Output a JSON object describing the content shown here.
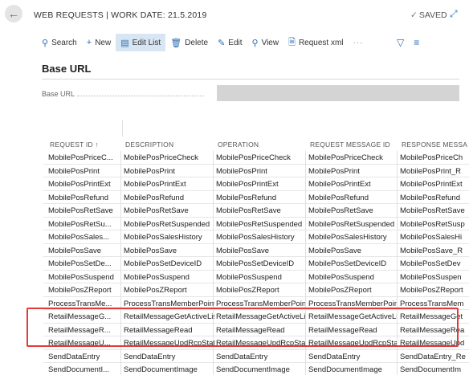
{
  "header": {
    "back_icon": "arrow-left-icon",
    "title": "WEB REQUESTS | WORK DATE: 21.5.2019",
    "saved_label": "SAVED",
    "expand_icon": "expand-icon"
  },
  "toolbar": {
    "search": "Search",
    "new": "New",
    "edit_list": "Edit List",
    "delete": "Delete",
    "edit": "Edit",
    "view": "View",
    "request_xml": "Request xml",
    "more": "···"
  },
  "section": {
    "title": "Base URL",
    "field_label": "Base URL",
    "field_value": ""
  },
  "table": {
    "columns": [
      "REQUEST ID ↑",
      "DESCRIPTION",
      "OPERATION",
      "REQUEST MESSAGE ID",
      "RESPONSE MESSA"
    ],
    "rows": [
      [
        "MobilePosPriceC...",
        "MobilePosPriceCheck",
        "MobilePosPriceCheck",
        "MobilePosPriceCheck",
        "MobilePosPriceCh"
      ],
      [
        "MobilePosPrint",
        "MobilePosPrint",
        "MobilePosPrint",
        "MobilePosPrint",
        "MobilePosPrint_R"
      ],
      [
        "MobilePosPrintExt",
        "MobilePosPrintExt",
        "MobilePosPrintExt",
        "MobilePosPrintExt",
        "MobilePosPrintExt"
      ],
      [
        "MobilePosRefund",
        "MobilePosRefund",
        "MobilePosRefund",
        "MobilePosRefund",
        "MobilePosRefund"
      ],
      [
        "MobilePosRetSave",
        "MobilePosRetSave",
        "MobilePosRetSave",
        "MobilePosRetSave",
        "MobilePosRetSave"
      ],
      [
        "MobilePosRetSu...",
        "MobilePosRetSuspended",
        "MobilePosRetSuspended",
        "MobilePosRetSuspended",
        "MobilePosRetSusp"
      ],
      [
        "MobilePosSales...",
        "MobilePosSalesHistory",
        "MobilePosSalesHistory",
        "MobilePosSalesHistory",
        "MobilePosSalesHi"
      ],
      [
        "MobilePosSave",
        "MobilePosSave",
        "MobilePosSave",
        "MobilePosSave",
        "MobilePosSave_R"
      ],
      [
        "MobilePosSetDe...",
        "MobilePosSetDeviceID",
        "MobilePosSetDeviceID",
        "MobilePosSetDeviceID",
        "MobilePosSetDev"
      ],
      [
        "MobilePosSuspend",
        "MobilePosSuspend",
        "MobilePosSuspend",
        "MobilePosSuspend",
        "MobilePosSuspen"
      ],
      [
        "MobilePosZReport",
        "MobilePosZReport",
        "MobilePosZReport",
        "MobilePosZReport",
        "MobilePosZReport"
      ],
      [
        "ProcessTransMe...",
        "ProcessTransMemberPoints",
        "ProcessTransMemberPoints",
        "ProcessTransMemberPoints",
        "ProcessTransMem"
      ],
      [
        "RetailMessageG...",
        "RetailMessageGetActiveList",
        "RetailMessageGetActiveList",
        "RetailMessageGetActiveList",
        "RetailMessageGet"
      ],
      [
        "RetailMessageR...",
        "RetailMessageRead",
        "RetailMessageRead",
        "RetailMessageRead",
        "RetailMessageRea"
      ],
      [
        "RetailMessageU...",
        "RetailMessageUpdRcpStat...",
        "RetailMessageUpdRcpStat...",
        "RetailMessageUpdRcpStat...",
        "RetailMessageUpd"
      ],
      [
        "SendDataEntry",
        "SendDataEntry",
        "SendDataEntry",
        "SendDataEntry",
        "SendDataEntry_Re"
      ],
      [
        "SendDocumentI...",
        "SendDocumentImage",
        "SendDocumentImage",
        "SendDocumentImage",
        "SendDocumentIm"
      ]
    ]
  }
}
